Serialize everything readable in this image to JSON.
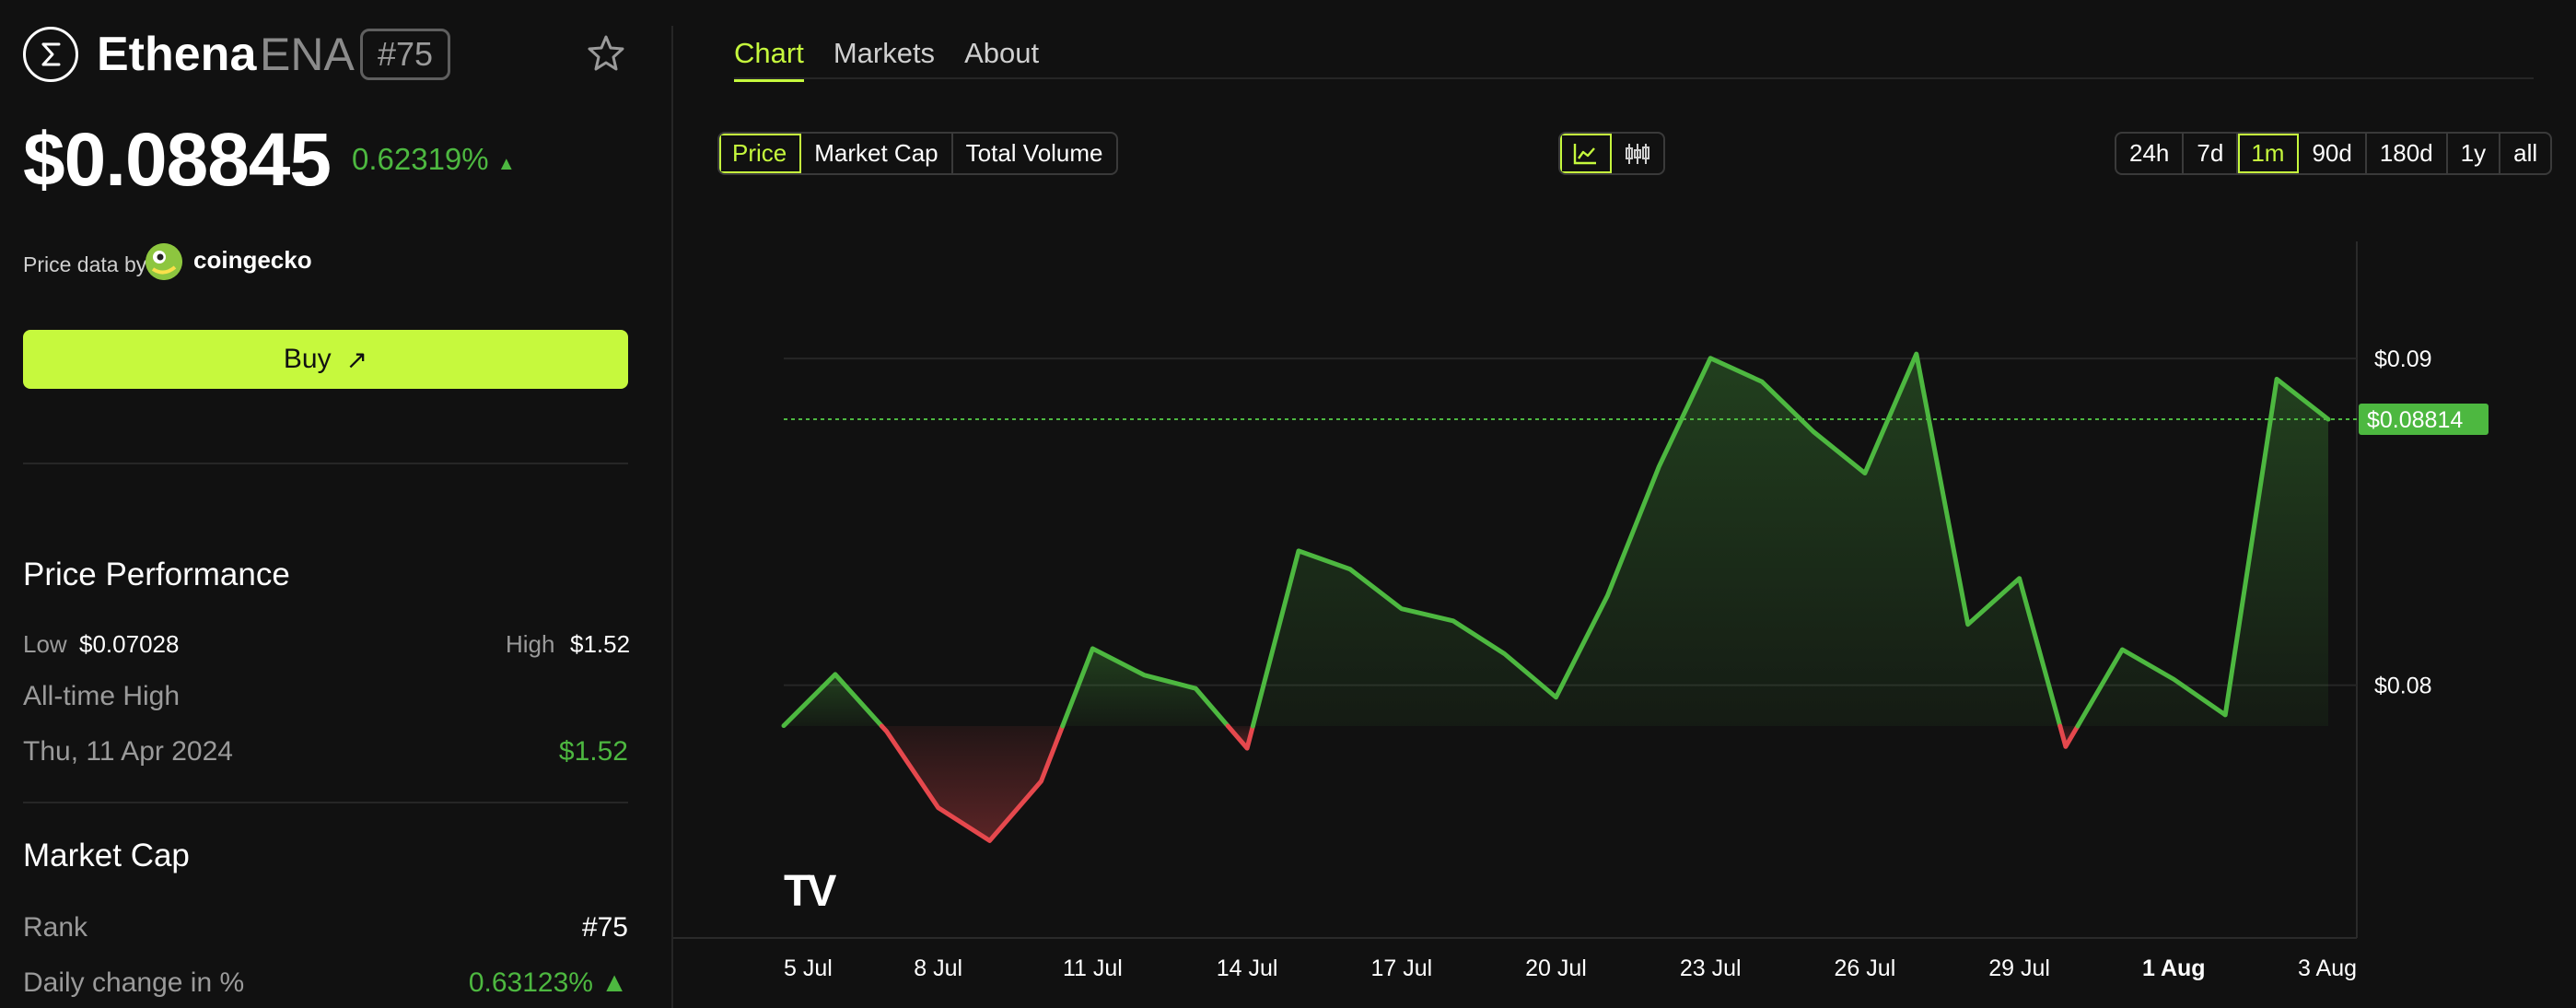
{
  "token": {
    "name": "Ethena",
    "symbol": "ENA",
    "rank_badge": "#75",
    "price": "$0.08845",
    "change": "0.62319%",
    "change_arrow": "▲",
    "price_data_label": "Price data by",
    "provider": "coingecko"
  },
  "buy": {
    "label": "Buy",
    "arrow": "↗"
  },
  "performance": {
    "title": "Price Performance",
    "low_label": "Low",
    "low_value": "$0.07028",
    "high_label": "High",
    "high_value": "$1.52",
    "ath_label": "All-time High",
    "ath_date": "Thu, 11 Apr 2024",
    "ath_value": "$1.52"
  },
  "market_cap": {
    "title": "Market Cap",
    "rank_label": "Rank",
    "rank_value": "#75",
    "daily_label": "Daily change in %",
    "daily_value": "0.63123% ▲"
  },
  "tabs": [
    {
      "label": "Chart",
      "active": true
    },
    {
      "label": "Markets",
      "active": false
    },
    {
      "label": "About",
      "active": false
    }
  ],
  "metric_options": [
    "Price",
    "Market Cap",
    "Total Volume"
  ],
  "metric_selected": "Price",
  "chart_type_icons": [
    "line-chart-icon",
    "candlestick-icon"
  ],
  "range_options": [
    "24h",
    "7d",
    "1m",
    "90d",
    "180d",
    "1y",
    "all"
  ],
  "range_selected": "1m",
  "colors": {
    "accent": "#c6f93d",
    "up": "#4db840",
    "down": "#e5484d",
    "background": "#111111"
  },
  "chart_data": {
    "type": "area",
    "baseline": 0.07875,
    "current_price_label": "$0.08814",
    "current_price": 0.08814,
    "ylim": [
      0.0726,
      0.0935
    ],
    "y_ticks": [
      {
        "value": 0.08,
        "label": "$0.08"
      },
      {
        "value": 0.09,
        "label": "$0.09"
      }
    ],
    "x_ticks": [
      {
        "x": 0,
        "label": "5 Jul",
        "bold": false
      },
      {
        "x": 3,
        "label": "8 Jul",
        "bold": false
      },
      {
        "x": 6,
        "label": "11 Jul",
        "bold": false
      },
      {
        "x": 9,
        "label": "14 Jul",
        "bold": false
      },
      {
        "x": 12,
        "label": "17 Jul",
        "bold": false
      },
      {
        "x": 15,
        "label": "20 Jul",
        "bold": false
      },
      {
        "x": 18,
        "label": "23 Jul",
        "bold": false
      },
      {
        "x": 21,
        "label": "26 Jul",
        "bold": false
      },
      {
        "x": 24,
        "label": "29 Jul",
        "bold": false
      },
      {
        "x": 27,
        "label": "1 Aug",
        "bold": true
      },
      {
        "x": 30,
        "label": "3 Aug",
        "bold": false
      }
    ],
    "xlim": [
      0,
      30
    ],
    "points": [
      [
        0.0,
        0.07876
      ],
      [
        1.0,
        0.08033
      ],
      [
        2.0,
        0.07858
      ],
      [
        3.0,
        0.07625
      ],
      [
        4.0,
        0.07524
      ],
      [
        5.0,
        0.07706
      ],
      [
        6.0,
        0.08112
      ],
      [
        7.0,
        0.08031
      ],
      [
        8.0,
        0.0799
      ],
      [
        9.0,
        0.07807
      ],
      [
        10.0,
        0.08411
      ],
      [
        11.0,
        0.08355
      ],
      [
        12.0,
        0.08234
      ],
      [
        13.0,
        0.08197
      ],
      [
        14.0,
        0.08096
      ],
      [
        15.0,
        0.07963
      ],
      [
        16.0,
        0.08274
      ],
      [
        17.0,
        0.08669
      ],
      [
        18.0,
        0.09001
      ],
      [
        19.0,
        0.08929
      ],
      [
        20.0,
        0.08776
      ],
      [
        21.0,
        0.08649
      ],
      [
        22.0,
        0.09014
      ],
      [
        23.0,
        0.08186
      ],
      [
        24.0,
        0.08327
      ],
      [
        24.9,
        0.07812
      ],
      [
        26.0,
        0.08109
      ],
      [
        27.0,
        0.08018
      ],
      [
        28.0,
        0.07909
      ],
      [
        29.0,
        0.08937
      ],
      [
        30.0,
        0.08814
      ]
    ],
    "watermark": "TV"
  }
}
